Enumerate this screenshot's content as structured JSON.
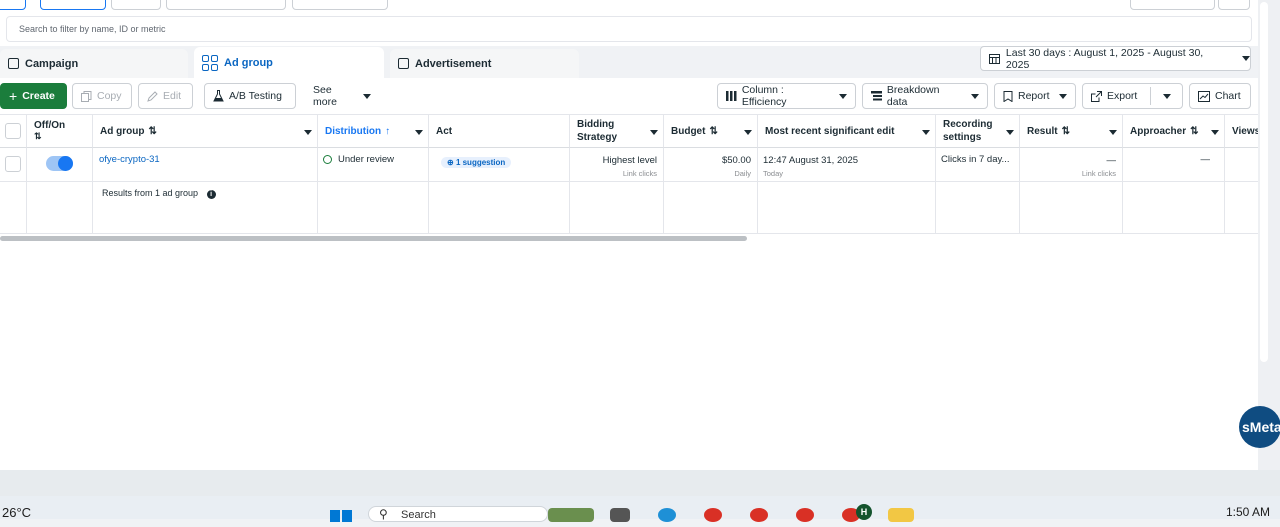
{
  "search": {
    "placeholder": "Search to filter by name, ID or metric"
  },
  "tabs": [
    {
      "label": "Campaign",
      "icon": "campaign-icon"
    },
    {
      "label": "Ad group",
      "icon": "ad-group-grid-icon"
    },
    {
      "label": "Advertisement",
      "icon": "advertisement-icon"
    }
  ],
  "date_range": "Last 30 days : August 1, 2025 - August 30, 2025",
  "toolbar": {
    "create": "Create",
    "copy": "Copy",
    "edit": "Edit",
    "ab_testing": "A/B Testing",
    "see_more": "See more",
    "column": "Column : Efficiency",
    "breakdown": "Breakdown data",
    "report": "Report",
    "export": "Export",
    "chart": "Chart"
  },
  "columns": {
    "off_on": "Off/On",
    "ad_group": "Ad group",
    "distribution": "Distribution",
    "act": "Act",
    "bidding_1": "Bidding",
    "bidding_2": "Strategy",
    "budget": "Budget",
    "recent_edit": "Most recent significant edit",
    "recording_1": "Recording",
    "recording_2": "settings",
    "result": "Result",
    "approacher": "Approacher",
    "views": "Views"
  },
  "row": {
    "name": "ofye-crypto-31",
    "distribution": "Under review",
    "act": "1 suggestion",
    "bidding": "Highest level",
    "bidding_sub": "Link clicks",
    "budget": "$50.00",
    "budget_sub": "Daily",
    "edit_time": "12:47 August 31, 2025",
    "edit_sub": "Today",
    "recording": "Clicks in 7 day...",
    "result": "—",
    "result_sub": "Link clicks",
    "approacher": "—"
  },
  "summary": "Results from 1 ad group",
  "taskbar": {
    "weather": "26°C",
    "search": "Search",
    "time": "1:50 AM"
  },
  "badge": "sMeta"
}
